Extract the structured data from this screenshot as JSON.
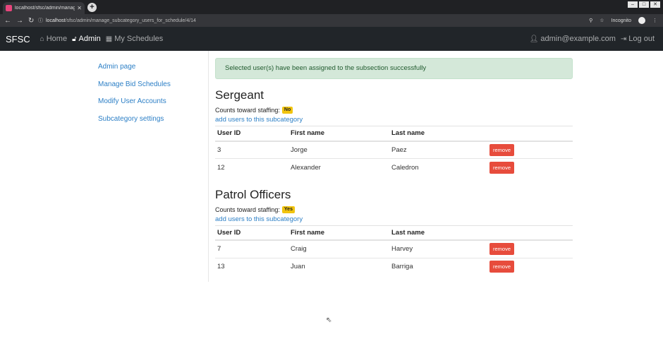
{
  "browser": {
    "tab_title": "localhost/sfsc/admin/manage_s...",
    "url_host": "localhost",
    "url_path": "/sfsc/admin/manage_subcategory_users_for_schedule/4/14",
    "incognito_label": "Incognito"
  },
  "navbar": {
    "brand": "SFSC",
    "links": [
      {
        "label": "Home",
        "icon": "home-icon"
      },
      {
        "label": "Admin",
        "icon": "lock-icon"
      },
      {
        "label": "My Schedules",
        "icon": "calendar-icon"
      }
    ],
    "user": "admin@example.com",
    "logout": "Log out"
  },
  "sidebar": {
    "items": [
      {
        "label": "Admin page"
      },
      {
        "label": "Manage Bid Schedules"
      },
      {
        "label": "Modify User Accounts"
      },
      {
        "label": "Subcategory settings"
      }
    ]
  },
  "alert": "Selected user(s) have been assigned to the subsection successfully",
  "table_headers": [
    "User ID",
    "First name",
    "Last name"
  ],
  "remove_label": "remove",
  "counts_label": "Counts toward staffing:",
  "add_users_label": "add users to this subcategory",
  "subcategories": [
    {
      "name": "Sergeant",
      "counts": "No",
      "users": [
        {
          "id": "3",
          "first": "Jorge",
          "last": "Paez"
        },
        {
          "id": "12",
          "first": "Alexander",
          "last": "Caledron"
        }
      ]
    },
    {
      "name": "Patrol Officers",
      "counts": "Yes",
      "users": [
        {
          "id": "7",
          "first": "Craig",
          "last": "Harvey"
        },
        {
          "id": "13",
          "first": "Juan",
          "last": "Barriga"
        }
      ]
    }
  ],
  "colors": {
    "navbar": "#212529",
    "link": "#2c7fc6",
    "badge": "#f1c40f",
    "danger": "#e74c3c",
    "alert_bg": "#d4e8d9"
  }
}
